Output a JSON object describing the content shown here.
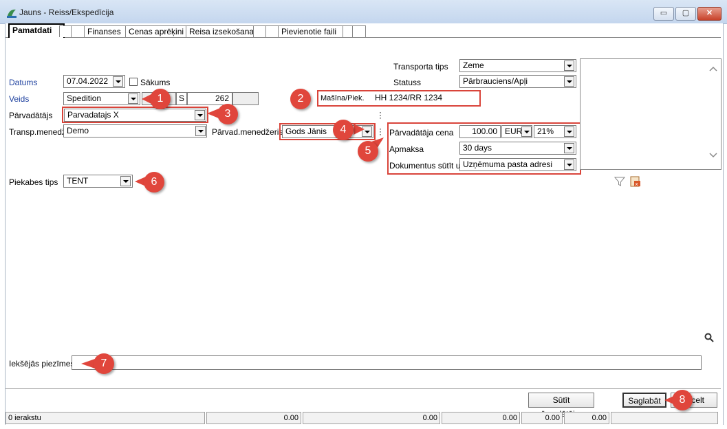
{
  "window": {
    "title": "Jauns - Reiss/Ekspedīcija",
    "controls": {
      "minimize": "▭",
      "maximize": "▢",
      "close": "✕"
    }
  },
  "tabs": [
    {
      "label": "Pamatdati",
      "active": true
    },
    {
      "label": ""
    },
    {
      "label": ""
    },
    {
      "label": "Finanses"
    },
    {
      "label": "Cenas aprēķini"
    },
    {
      "label": "Reisa izsekošana"
    },
    {
      "label": ""
    },
    {
      "label": ""
    },
    {
      "label": "Pievienotie faili"
    },
    {
      "label": ""
    },
    {
      "label": ""
    }
  ],
  "form": {
    "datums": {
      "label": "Datums",
      "value": "07.04.2022"
    },
    "sakums": {
      "label": "Sākums",
      "checked": false
    },
    "veids": {
      "label": "Veids",
      "value": "Spedition",
      "s_label": "S",
      "number": "262"
    },
    "parvadatajs": {
      "label": "Pārvadātājs",
      "value": "Parvadatajs X"
    },
    "transp_menedz": {
      "label": "Transp.menedž.",
      "value": "Demo"
    },
    "parvad_menedzeris": {
      "label": "Pārvad.menedžeris",
      "value": "Gods Jānis"
    },
    "transporta_tips": {
      "label": "Transporta tips",
      "value": "Zeme"
    },
    "statuss": {
      "label": "Statuss",
      "value": "Pārbrauciens/Apļi"
    },
    "masina": {
      "label": "Mašīna/Piek.",
      "value": "HH 1234/RR 1234"
    },
    "parvadataja_cena": {
      "label": "Pārvadātāja cena",
      "value": "100.00",
      "currency": "EUR",
      "vat": "21%"
    },
    "apmaksa": {
      "label": "Apmaksa",
      "value": "30 days"
    },
    "dokumentus_sutit": {
      "label": "Dokumentus sūtīt uz",
      "value": "Uzņēmuma pasta adresi"
    },
    "piekabes_tips": {
      "label": "Piekabes tips",
      "value": "TENT"
    },
    "ieksejas_piezimes": {
      "label": "Iekšējās piezīmes",
      "value": ""
    }
  },
  "markers": [
    "1",
    "2",
    "3",
    "4",
    "5",
    "6",
    "7",
    "8"
  ],
  "buttons": {
    "sutit": "Sūtīt pārvadātājam",
    "saglabat": "Saglabāt",
    "atcelt_partial": "celt"
  },
  "statusbar": {
    "count": "0 ierakstu",
    "v1": "0.00",
    "v2": "0.00",
    "v3": "0.00",
    "v4": "0.00",
    "v5": "0.00"
  },
  "colors": {
    "label_blue": "#1c3f9e",
    "highlight_red": "#d9443a",
    "marker_red": "#e0463c"
  },
  "icons": [
    "app-icon",
    "filter-icon",
    "excel-export-icon",
    "search-icon",
    "scroll-up-icon",
    "scroll-down-icon",
    "more-options-icon"
  ]
}
